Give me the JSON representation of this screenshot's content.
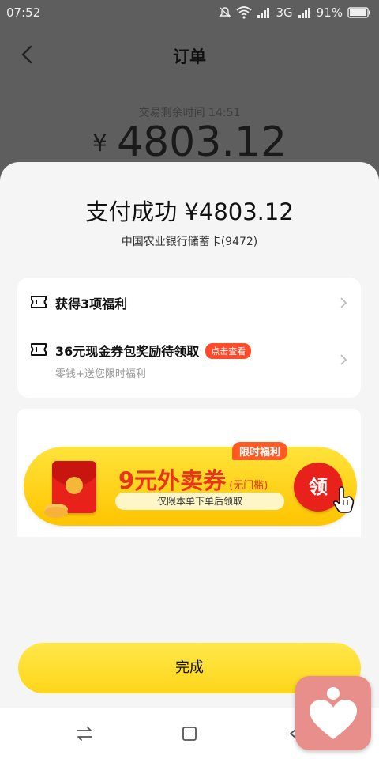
{
  "status_bar": {
    "time": "07:52",
    "network": "3G",
    "battery": "91%",
    "icons": [
      "mute-icon",
      "wifi-icon",
      "signal-icon",
      "battery-icon"
    ]
  },
  "header": {
    "title": "订单",
    "back_icon": "chevron-left-icon"
  },
  "order": {
    "timer": "交易剩余时间 14:51",
    "currency_symbol": "¥",
    "amount": "4803.12"
  },
  "payment": {
    "title": "支付成功 ¥4803.12",
    "bank": "中国农业银行储蓄卡(9472)"
  },
  "benefits": {
    "row1_label": "获得3项福利",
    "row2_label": "36元现金券包奖励待领取",
    "row2_badge": "点击查看",
    "row2_sub": "零钱+送您限时福利"
  },
  "promo": {
    "title": "9元外卖券",
    "title_note": "(无门槛)",
    "tag": "限时福利",
    "subtitle": "仅限本单下单后领取",
    "claim_label": "领"
  },
  "footer": {
    "done_label": "完成"
  },
  "colors": {
    "accent_yellow": "#ffd51a",
    "accent_red": "#e8211b",
    "badge_red": "#ff4b2b"
  }
}
